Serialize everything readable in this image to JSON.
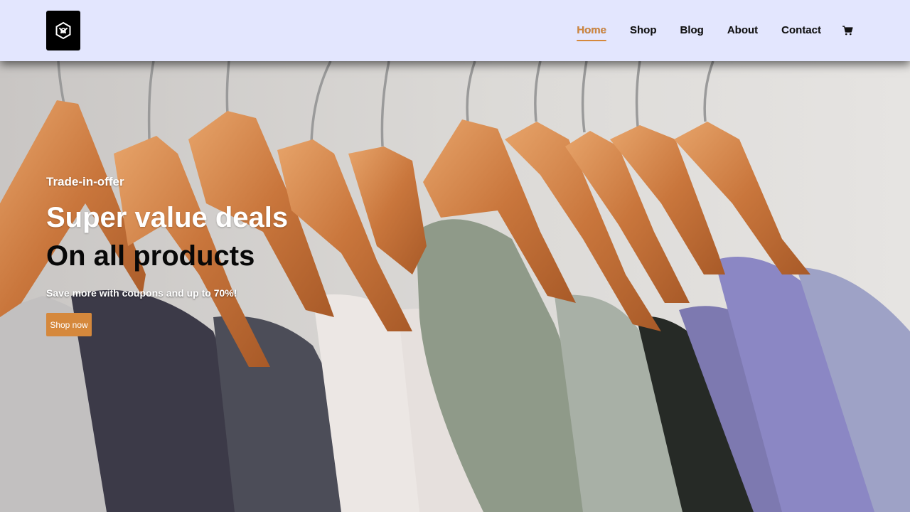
{
  "brand": {
    "logo_icon": "hexagon-knot-logo-icon"
  },
  "nav": {
    "items": [
      {
        "label": "Home",
        "active": true
      },
      {
        "label": "Shop"
      },
      {
        "label": "Blog"
      },
      {
        "label": "About"
      },
      {
        "label": "Contact"
      }
    ],
    "cart_icon": "shopping-cart-icon"
  },
  "hero": {
    "eyebrow": "Trade-in-offer",
    "headline_1": "Super value deals",
    "headline_2": "On all products",
    "subtext": "Save more with coupons and up to 70%!",
    "cta_label": "Shop now",
    "background_image": "clothes-on-wooden-hangers-photo"
  },
  "colors": {
    "header_bg": "#e3e6fe",
    "accent": "#d5883c",
    "text_dark": "#111111",
    "text_light": "#ffffff"
  }
}
